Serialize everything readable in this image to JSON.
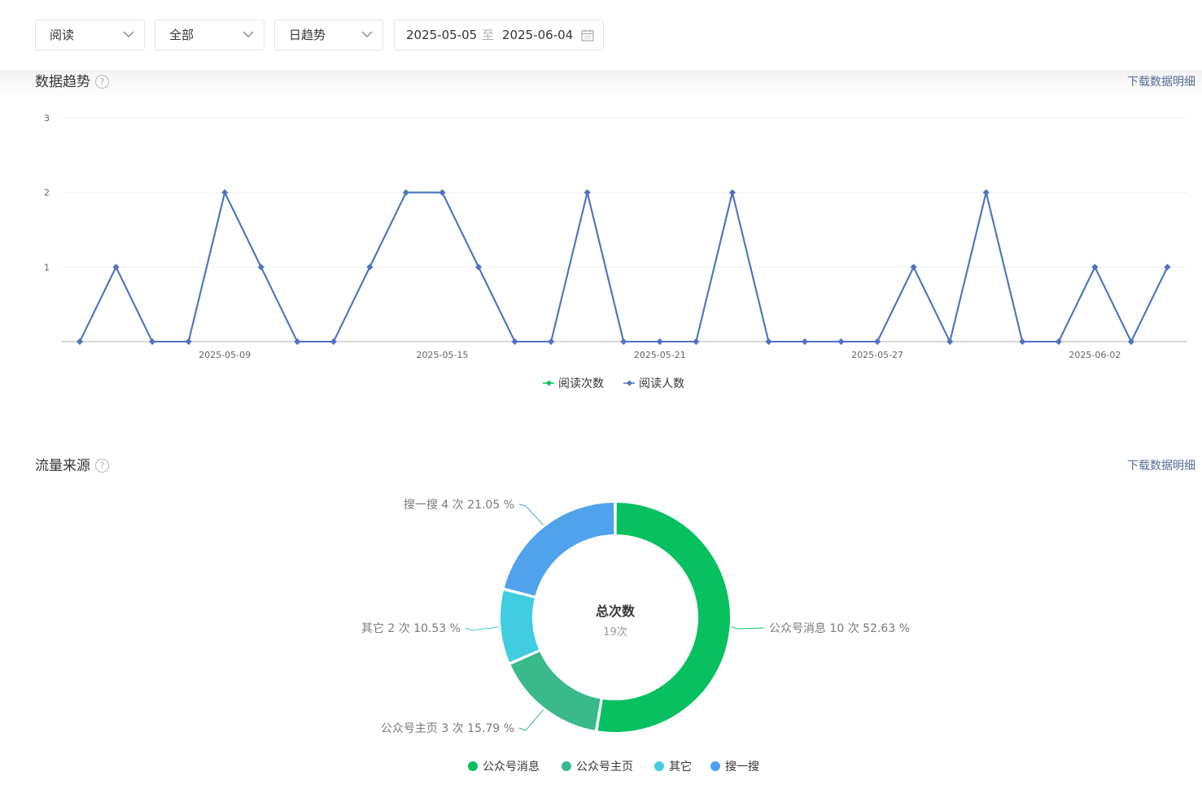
{
  "filters": {
    "metric": "阅读",
    "scope": "全部",
    "granularity": "日趋势",
    "date_start": "2025-05-05",
    "date_separator": "至",
    "date_end": "2025-06-04"
  },
  "trend": {
    "title": "数据趋势",
    "help": "?",
    "download_label": "下载数据明细"
  },
  "traffic": {
    "title": "流量来源",
    "help": "?",
    "download_label": "下载数据明细"
  },
  "chart_data": [
    {
      "type": "line",
      "x": [
        "2025-05-05",
        "2025-05-06",
        "2025-05-07",
        "2025-05-08",
        "2025-05-09",
        "2025-05-10",
        "2025-05-11",
        "2025-05-12",
        "2025-05-13",
        "2025-05-14",
        "2025-05-15",
        "2025-05-16",
        "2025-05-17",
        "2025-05-18",
        "2025-05-19",
        "2025-05-20",
        "2025-05-21",
        "2025-05-22",
        "2025-05-23",
        "2025-05-24",
        "2025-05-25",
        "2025-05-26",
        "2025-05-27",
        "2025-05-28",
        "2025-05-29",
        "2025-05-30",
        "2025-05-31",
        "2025-06-01",
        "2025-06-02",
        "2025-06-03",
        "2025-06-04"
      ],
      "x_tick_labels": [
        "2025-05-09",
        "2025-05-15",
        "2025-05-21",
        "2025-05-27",
        "2025-06-02"
      ],
      "ylim": [
        0,
        3
      ],
      "y_ticks": [
        "1",
        "2",
        "3"
      ],
      "grid": true,
      "legend_position": "bottom",
      "series": [
        {
          "name": "阅读次数",
          "color": "#07c160",
          "values": [
            0,
            1,
            0,
            0,
            2,
            1,
            0,
            0,
            1,
            2,
            2,
            1,
            0,
            0,
            2,
            0,
            0,
            0,
            2,
            0,
            0,
            0,
            0,
            1,
            0,
            2,
            0,
            0,
            1,
            0,
            1
          ]
        },
        {
          "name": "阅读人数",
          "color": "#5470c6",
          "values": [
            0,
            1,
            0,
            0,
            2,
            1,
            0,
            0,
            1,
            2,
            2,
            1,
            0,
            0,
            2,
            0,
            0,
            0,
            2,
            0,
            0,
            0,
            0,
            1,
            0,
            2,
            0,
            0,
            1,
            0,
            1
          ]
        }
      ]
    },
    {
      "type": "pie",
      "center_title": "总次数",
      "center_value": "19次",
      "legend_position": "bottom",
      "slices": [
        {
          "name": "公众号消息",
          "value": 10,
          "percent": 52.63,
          "label": "公众号消息 10 次 52.63 %",
          "color": "#07c160"
        },
        {
          "name": "公众号主页",
          "value": 3,
          "percent": 15.79,
          "label": "公众号主页 3 次 15.79 %",
          "color": "#3ab98b"
        },
        {
          "name": "其它",
          "value": 2,
          "percent": 10.53,
          "label": "其它 2 次 10.53 %",
          "color": "#40cde0"
        },
        {
          "name": "搜一搜",
          "value": 4,
          "percent": 21.05,
          "label": "搜一搜 4 次 21.05 %",
          "color": "#4fa2eb"
        }
      ]
    }
  ]
}
